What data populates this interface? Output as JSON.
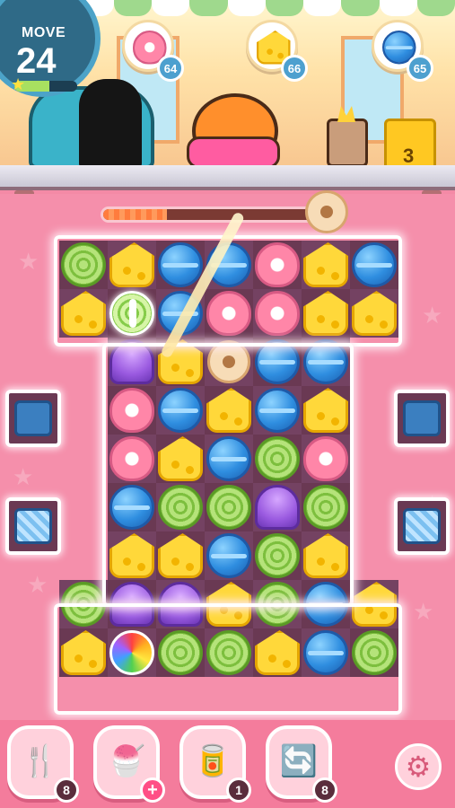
{
  "hud": {
    "move_label": "MOVE",
    "moves_remaining": "24",
    "move_meter_fraction": 0.55
  },
  "goals": [
    {
      "item": "donut",
      "count": "64"
    },
    {
      "item": "cheese",
      "count": "66"
    },
    {
      "item": "macaron",
      "count": "65"
    }
  ],
  "crown_count": "3",
  "score_progress_fraction": 0.28,
  "board": {
    "rows": [
      [
        "roll",
        "cheese",
        "macaron",
        "macaron",
        "donut",
        "cheese",
        "macaron"
      ],
      [
        "cheese",
        "roll-special",
        "macaron",
        "donut",
        "donut",
        "cheese",
        "cheese"
      ],
      [
        "",
        "cupcake",
        "cheese",
        "cookie",
        "macaron",
        "macaron",
        ""
      ],
      [
        "",
        "donut",
        "macaron",
        "cheese",
        "macaron",
        "cheese",
        ""
      ],
      [
        "",
        "donut",
        "cheese",
        "macaron",
        "roll",
        "donut",
        ""
      ],
      [
        "",
        "macaron",
        "roll",
        "roll",
        "cupcake",
        "roll",
        ""
      ],
      [
        "",
        "cheese",
        "cheese",
        "macaron",
        "roll",
        "cheese",
        ""
      ],
      [
        "roll",
        "cupcake",
        "cupcake",
        "cheese",
        "roll",
        "macaron",
        "cheese"
      ],
      [
        "cheese",
        "rainbow",
        "roll",
        "roll",
        "cheese",
        "macaron",
        "roll"
      ]
    ]
  },
  "side_blockers": [
    {
      "side": "left",
      "kind": "box"
    },
    {
      "side": "left",
      "kind": "ice"
    },
    {
      "side": "right",
      "kind": "box"
    },
    {
      "side": "right",
      "kind": "ice"
    }
  ],
  "boosters": [
    {
      "name": "fork",
      "glyph": "🍴",
      "count": "8"
    },
    {
      "name": "rainbow-cone",
      "glyph": "🍧",
      "count": "+"
    },
    {
      "name": "soda-can",
      "glyph": "🥫",
      "count": "1"
    },
    {
      "name": "shuffle",
      "glyph": "🔄",
      "count": "8"
    }
  ],
  "settings_icon": "⚙"
}
